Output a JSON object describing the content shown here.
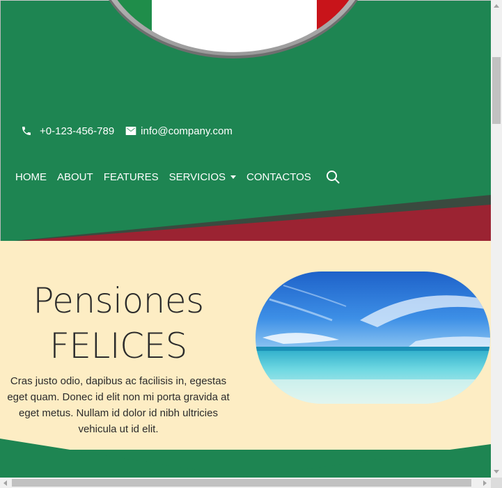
{
  "colors": {
    "brand_green": "#1e8552",
    "band_dark": "#3a4a3f",
    "band_red": "#9b2332",
    "hero_bg": "#fdedc4",
    "text_dark": "#2b2b2b"
  },
  "header": {
    "logo": "italy-flag-circle-logo",
    "contact": {
      "phone_icon": "phone-icon",
      "phone": "+0-123-456-789",
      "email_icon": "envelope-icon",
      "email": "info@company.com"
    },
    "nav": {
      "items": [
        "HOME",
        "ABOUT",
        "FEATURES",
        "SERVICIOS",
        "CONTACTOS"
      ],
      "dropdown_icon": "caret-down-icon",
      "search_icon": "search-icon"
    }
  },
  "hero": {
    "title_line1": "Pensiones",
    "title_line2": "FELICES",
    "text": "Cras justo odio, dapibus ac facilisis in, egestas eget quam. Donec id elit non mi porta gravida at eget metus. Nullam id dolor id nibh ultricies vehicula ut id elit.",
    "image": "beach-sea-sky-photo"
  }
}
